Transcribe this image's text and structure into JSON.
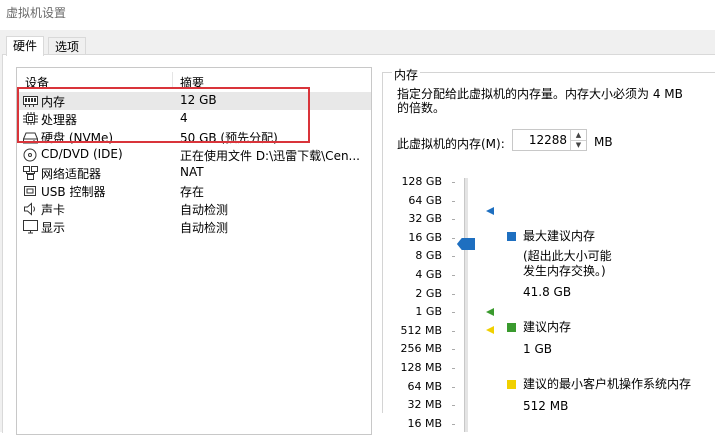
{
  "window": {
    "title": "虚拟机设置"
  },
  "tabs": [
    {
      "label": "硬件"
    },
    {
      "label": "选项"
    }
  ],
  "device_list": {
    "headers": {
      "device": "设备",
      "summary": "摘要"
    },
    "rows": [
      {
        "name": "内存",
        "summary": "12 GB",
        "icon": "memory-icon"
      },
      {
        "name": "处理器",
        "summary": "4",
        "icon": "cpu-icon"
      },
      {
        "name": "硬盘 (NVMe)",
        "summary": "50 GB (预先分配)",
        "icon": "hard-disk-icon"
      },
      {
        "name": "CD/DVD (IDE)",
        "summary": "正在使用文件 D:\\迅雷下载\\Cen...",
        "icon": "cd-dvd-icon"
      },
      {
        "name": "网络适配器",
        "summary": "NAT",
        "icon": "network-adapter-icon"
      },
      {
        "name": "USB 控制器",
        "summary": "存在",
        "icon": "usb-icon"
      },
      {
        "name": "声卡",
        "summary": "自动检测",
        "icon": "speaker-icon"
      },
      {
        "name": "显示",
        "summary": "自动检测",
        "icon": "monitor-icon"
      }
    ]
  },
  "memory": {
    "group_title": "内存",
    "description": "指定分配给此虚拟机的内存量。内存大小必须为 4 MB 的倍数。",
    "field_label": "此虚拟机的内存(M):",
    "value": "12288",
    "unit": "MB",
    "scale": [
      "128 GB",
      "64 GB",
      "32 GB",
      "16 GB",
      "8 GB",
      "4 GB",
      "2 GB",
      "1 GB",
      "512 MB",
      "256 MB",
      "128 MB",
      "64 MB",
      "32 MB",
      "16 MB"
    ],
    "legend": {
      "max_title": "最大建议内存",
      "max_note1": "(超出此大小可能",
      "max_note2": "发生内存交换。)",
      "max_value": "41.8 GB",
      "rec_title": "建议内存",
      "rec_value": "1 GB",
      "min_title": "建议的最小客户机操作系统内存",
      "min_value": "512 MB"
    }
  },
  "colors": {
    "max": "#1e6fc0",
    "recommended": "#3a9a2e",
    "minimum": "#f0d000",
    "highlight": "#d9343a"
  }
}
